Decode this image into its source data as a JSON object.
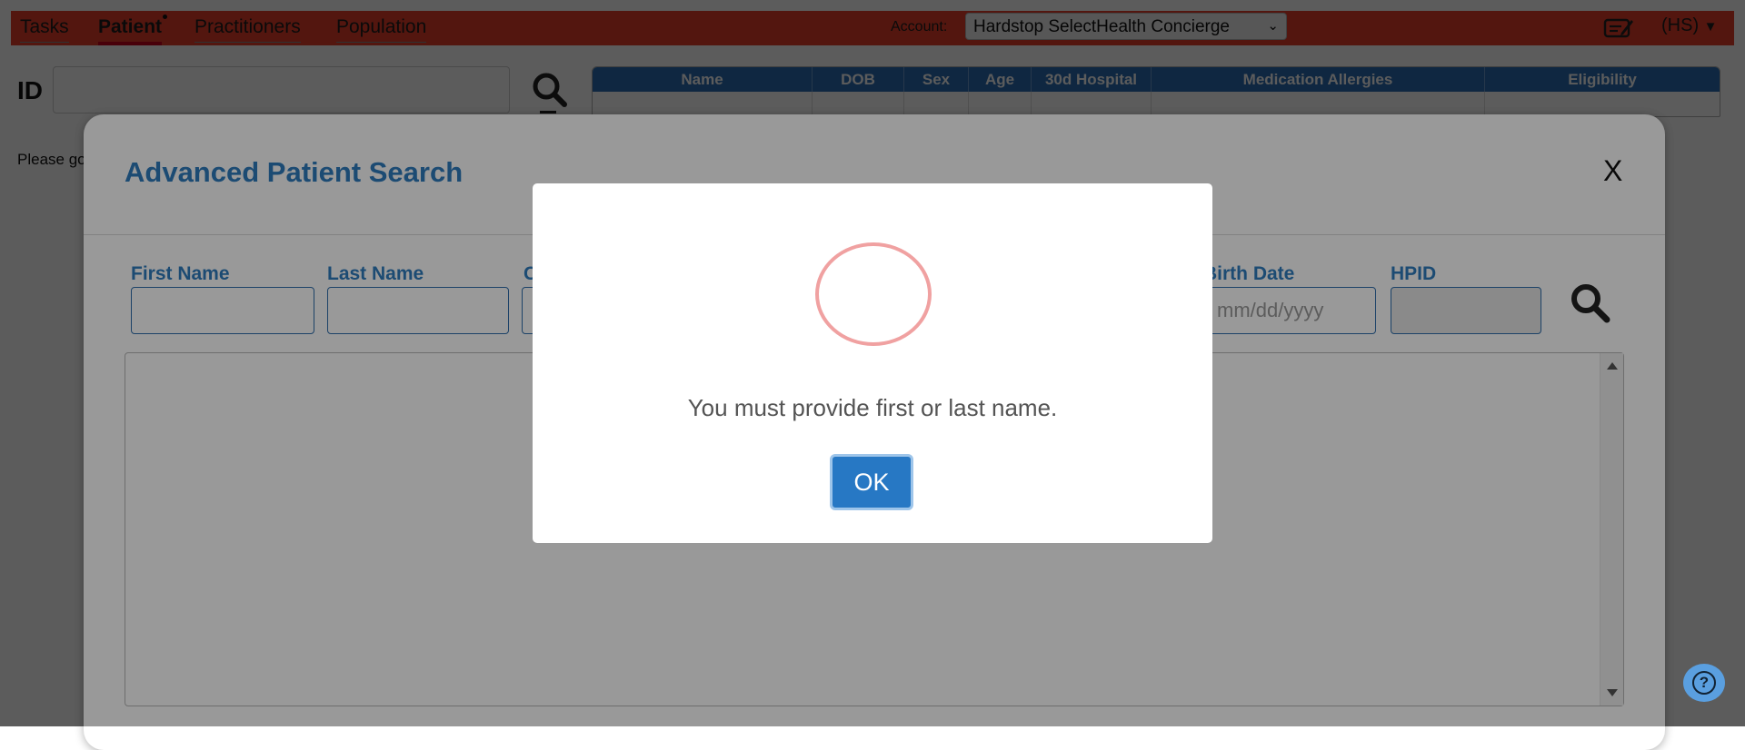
{
  "nav": {
    "tabs": [
      {
        "label": "Tasks"
      },
      {
        "label": "Patient"
      },
      {
        "label": "Practitioners"
      },
      {
        "label": "Population"
      }
    ],
    "account_label": "Account:",
    "account_value": "Hardstop SelectHealth Concierge",
    "user_badge": "(HS)",
    "icons": {
      "note": "note-edit-icon",
      "caret": "caret-down-icon"
    }
  },
  "patient_bar": {
    "id_label": "ID",
    "id_value": "",
    "table_headers": [
      "Name",
      "DOB",
      "Sex",
      "Age",
      "30d Hospital",
      "Medication Allergies",
      "Eligibility"
    ]
  },
  "page_hint": "Please go",
  "adv_search": {
    "title": "Advanced Patient Search",
    "close": "X",
    "fields": [
      {
        "label": "First Name",
        "value": "",
        "placeholder": ""
      },
      {
        "label": "Last Name",
        "value": "",
        "placeholder": ""
      },
      {
        "label": "C",
        "value": "",
        "placeholder": ""
      },
      {
        "label": "Birth Date",
        "value": "",
        "placeholder": "mm/dd/yyyy"
      },
      {
        "label": "HPID",
        "value": "",
        "placeholder": ""
      }
    ]
  },
  "alert": {
    "message": "You must provide first or last name.",
    "ok_label": "OK",
    "icon": "warning-circle-icon"
  },
  "help": {
    "label": "?"
  },
  "colors": {
    "nav_bg": "#e8402b",
    "accent_blue": "#2f7dc0",
    "table_header": "#2a6fb6",
    "ok_button": "#2778c4",
    "alert_ring": "#f0a1a1",
    "help_button": "#5a9fe0"
  }
}
